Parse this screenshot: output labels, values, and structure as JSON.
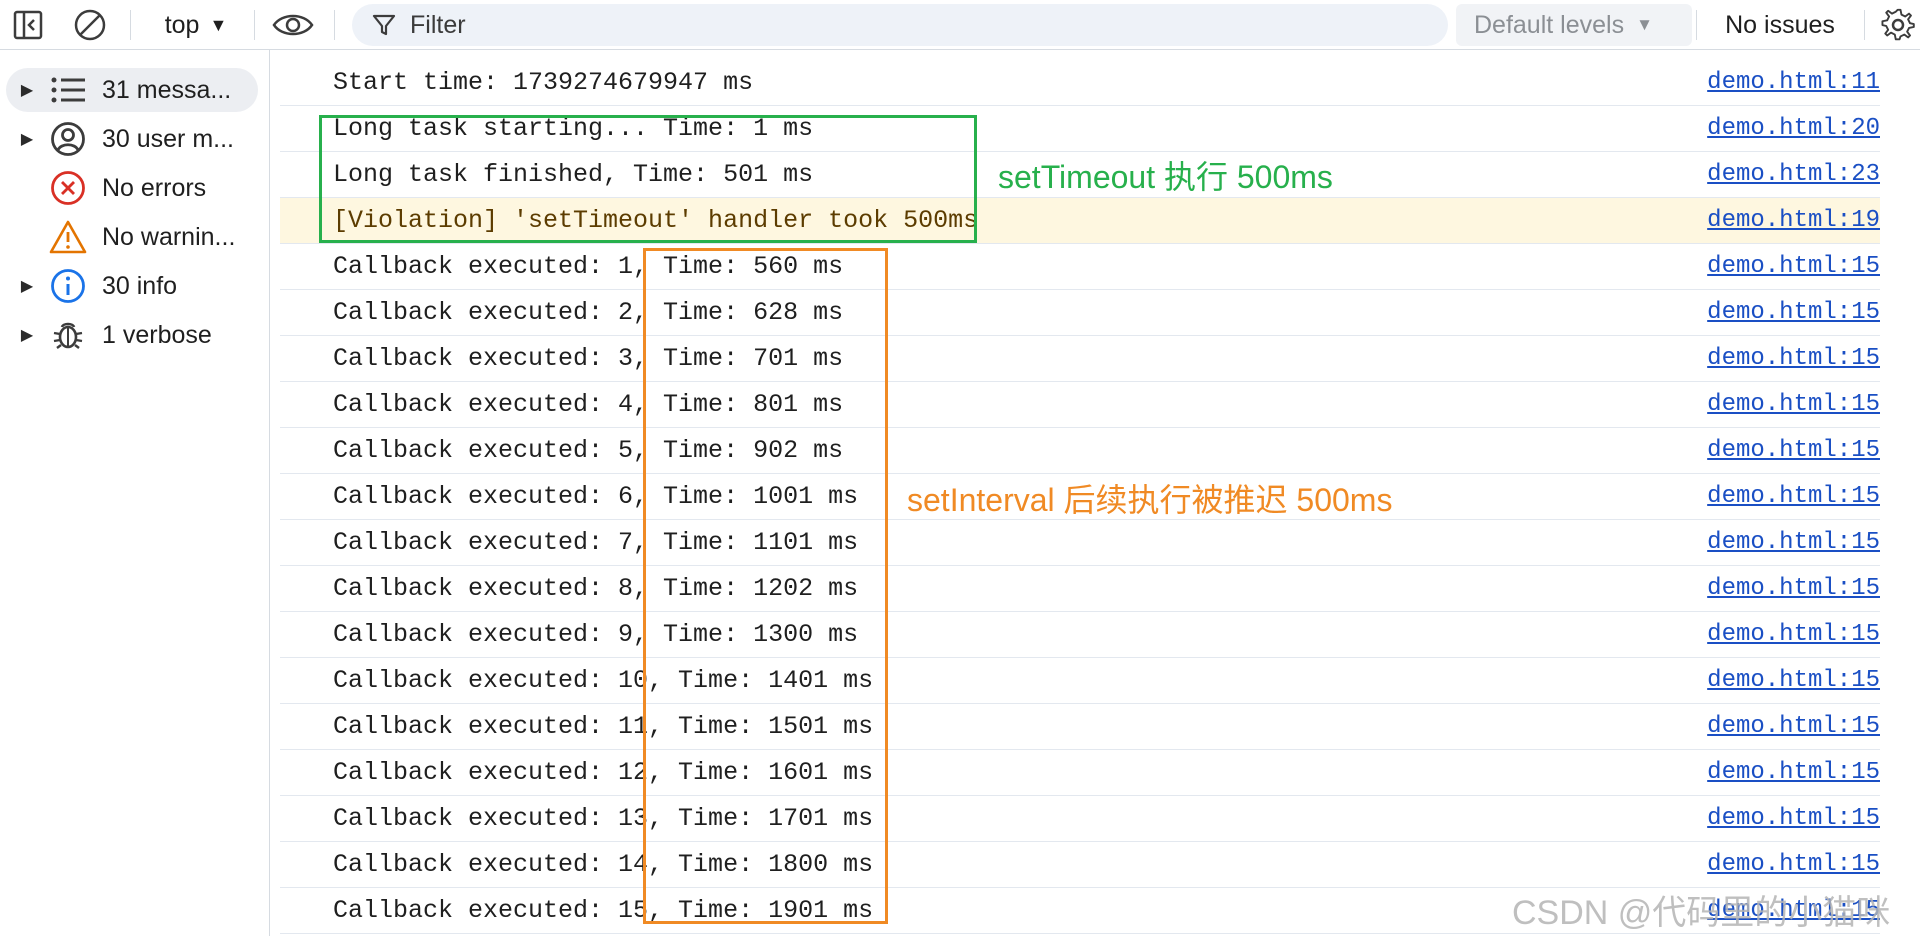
{
  "toolbar": {
    "context": "top",
    "filter_placeholder": "Filter",
    "levels": "Default levels",
    "issues": "No issues"
  },
  "sidebar": {
    "items": [
      {
        "label": "31 messa...",
        "icon": "list-icon",
        "expandable": true,
        "selected": true
      },
      {
        "label": "30 user m...",
        "icon": "user-icon",
        "expandable": true,
        "selected": false
      },
      {
        "label": "No errors",
        "icon": "error-icon",
        "expandable": false,
        "selected": false
      },
      {
        "label": "No warnin...",
        "icon": "warning-icon",
        "expandable": false,
        "selected": false
      },
      {
        "label": "30 info",
        "icon": "info-icon",
        "expandable": true,
        "selected": false
      },
      {
        "label": "1 verbose",
        "icon": "bug-icon",
        "expandable": true,
        "selected": false
      }
    ]
  },
  "colors": {
    "green": "#27b04c",
    "orange": "#f08a24",
    "link": "#1a4fc4",
    "warning_bg": "#fef7e0",
    "error": "#d93025",
    "warning": "#e37400",
    "info": "#1a73e8"
  },
  "console": {
    "rows": [
      {
        "text": "Start time: 1739274679947 ms",
        "source": "demo.html:11",
        "type": "log"
      },
      {
        "text": "Long task starting... Time: 1 ms",
        "source": "demo.html:20",
        "type": "log"
      },
      {
        "text": "Long task finished, Time: 501 ms",
        "source": "demo.html:23",
        "type": "log"
      },
      {
        "text": "[Violation] 'setTimeout' handler took 500ms",
        "source": "demo.html:19",
        "type": "warning"
      },
      {
        "text": "Callback executed: 1, Time: 560 ms",
        "source": "demo.html:15",
        "type": "log"
      },
      {
        "text": "Callback executed: 2, Time: 628 ms",
        "source": "demo.html:15",
        "type": "log"
      },
      {
        "text": "Callback executed: 3, Time: 701 ms",
        "source": "demo.html:15",
        "type": "log"
      },
      {
        "text": "Callback executed: 4, Time: 801 ms",
        "source": "demo.html:15",
        "type": "log"
      },
      {
        "text": "Callback executed: 5, Time: 902 ms",
        "source": "demo.html:15",
        "type": "log"
      },
      {
        "text": "Callback executed: 6, Time: 1001 ms",
        "source": "demo.html:15",
        "type": "log"
      },
      {
        "text": "Callback executed: 7, Time: 1101 ms",
        "source": "demo.html:15",
        "type": "log"
      },
      {
        "text": "Callback executed: 8, Time: 1202 ms",
        "source": "demo.html:15",
        "type": "log"
      },
      {
        "text": "Callback executed: 9, Time: 1300 ms",
        "source": "demo.html:15",
        "type": "log"
      },
      {
        "text": "Callback executed: 10, Time: 1401 ms",
        "source": "demo.html:15",
        "type": "log"
      },
      {
        "text": "Callback executed: 11, Time: 1501 ms",
        "source": "demo.html:15",
        "type": "log"
      },
      {
        "text": "Callback executed: 12, Time: 1601 ms",
        "source": "demo.html:15",
        "type": "log"
      },
      {
        "text": "Callback executed: 13, Time: 1701 ms",
        "source": "demo.html:15",
        "type": "log"
      },
      {
        "text": "Callback executed: 14, Time: 1800 ms",
        "source": "demo.html:15",
        "type": "log"
      },
      {
        "text": "Callback executed: 15, Time: 1901 ms",
        "source": "demo.html:15",
        "type": "log"
      }
    ]
  },
  "annotations": {
    "timeout_note": "setTimeout 执行 500ms",
    "interval_note": "setInterval 后续执行被推迟 500ms",
    "watermark": "CSDN @代码里的小猫咪"
  }
}
